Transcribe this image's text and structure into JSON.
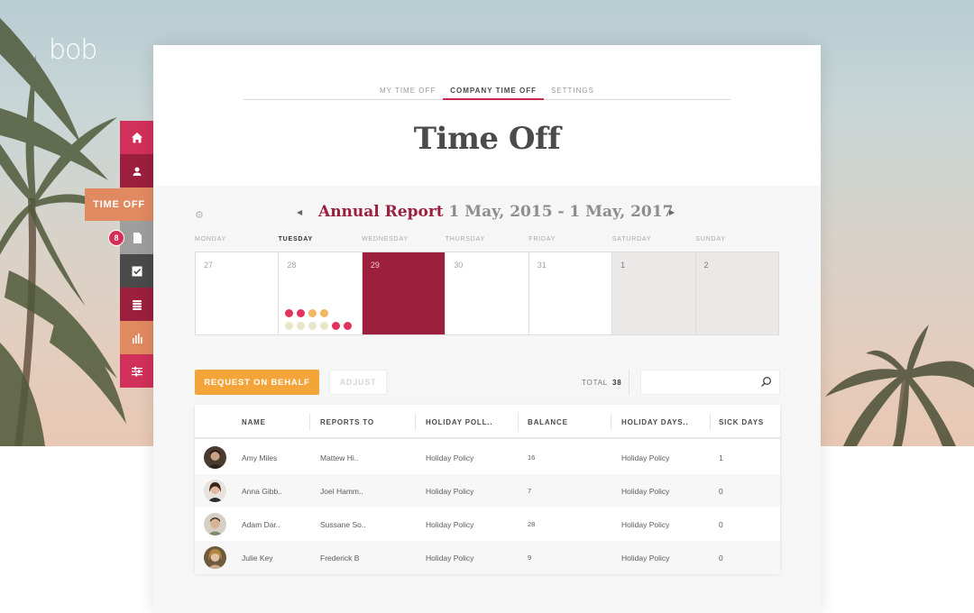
{
  "app": {
    "logo": "bob"
  },
  "sidenav": {
    "active_label": "TIME OFF",
    "badge_count": "8",
    "items": [
      {
        "icon": "home-icon",
        "color": "#d0305a"
      },
      {
        "icon": "people-icon",
        "color": "#9c1f3e"
      },
      {
        "icon": "document-icon",
        "color": "#9e9e9e"
      },
      {
        "icon": "checkbox-icon",
        "color": "#4a4a4a"
      },
      {
        "icon": "coins-icon",
        "color": "#9c1f3e"
      },
      {
        "icon": "bar-chart-icon",
        "color": "#e08a61"
      },
      {
        "icon": "sliders-icon",
        "color": "#d0305a"
      }
    ]
  },
  "tabs": [
    {
      "label": "MY TIME OFF",
      "active": false
    },
    {
      "label": "COMPANY TIME OFF",
      "active": true
    },
    {
      "label": "SETTINGS",
      "active": false
    }
  ],
  "page_title": "Time Off",
  "report": {
    "name": "Annual Report",
    "range": " 1 May, 2015 - 1 May, 2017"
  },
  "calendar": {
    "weekdays": [
      "MONDAY",
      "TUESDAY",
      "WEDNESDAY",
      "THURSDAY",
      "FRIDAY",
      "SATURDAY",
      "SUNDAY"
    ],
    "bold_weekday": "TUESDAY",
    "days": [
      "27",
      "28",
      "29",
      "30",
      "31",
      "1",
      "2"
    ],
    "today_index": 2,
    "weekend_indices": [
      5,
      6
    ],
    "dots_day_index": 1,
    "dot_rows": [
      [
        "#e0345f",
        "#e0345f",
        "#f2b661",
        "#f2b661"
      ],
      [
        "#e9e5c8",
        "#e9e5c8",
        "#e9e5c8",
        "#e9e5c8",
        "#e0345f",
        "#e0345f"
      ]
    ]
  },
  "actions": {
    "request_label": "REQUEST ON BEHALF",
    "adjust_label": "ADJUST",
    "total_label": "TOTAL",
    "total_value": "38",
    "search_placeholder": ""
  },
  "table": {
    "columns": [
      "NAME",
      "REPORTS TO",
      "HOLIDAY POLL..",
      "BALANCE",
      "HOLIDAY DAYS..",
      "SICK DAYS"
    ],
    "rows": [
      {
        "name": "Amy Miles",
        "reports_to": "Mattew Hi..",
        "policy": "Holiday Policy",
        "balance": "16",
        "holiday_days": "Holiday Policy",
        "sick_days": "1"
      },
      {
        "name": "Anna Gibb..",
        "reports_to": "Joel Hamm..",
        "policy": "Holiday Policy",
        "balance": "7",
        "holiday_days": "Holiday Policy",
        "sick_days": "0"
      },
      {
        "name": "Adam Dar..",
        "reports_to": "Sussane So..",
        "policy": "Holiday Policy",
        "balance": "28",
        "holiday_days": "Holiday Policy",
        "sick_days": "0"
      },
      {
        "name": "Julie Key",
        "reports_to": "Frederick B",
        "policy": "Holiday Policy",
        "balance": "9",
        "holiday_days": "Holiday Policy",
        "sick_days": "0"
      }
    ]
  },
  "colors": {
    "accent": "#9c1f3e",
    "primary_button": "#f4a53a",
    "timeoff_nav": "#e08a61"
  }
}
